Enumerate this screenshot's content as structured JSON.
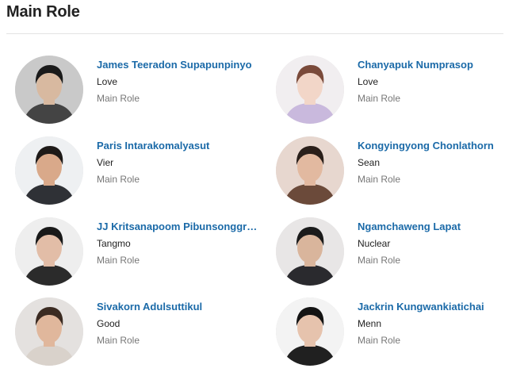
{
  "section": {
    "title": "Main Role"
  },
  "cast": [
    {
      "name": "James Teeradon Supapunpinyo",
      "character": "Love",
      "role": "Main Role",
      "avatar": {
        "bg": "#c9c9c9",
        "hair": "#1a1a1a",
        "skin": "#d8b9a0",
        "shirt": "#444444"
      }
    },
    {
      "name": "Chanyapuk Numprasop",
      "character": "Love",
      "role": "Main Role",
      "avatar": {
        "bg": "#f1eef0",
        "hair": "#7a4a3a",
        "skin": "#f2d6c8",
        "shirt": "#c9b9dd"
      }
    },
    {
      "name": "Paris Intarakomalyasut",
      "character": "Vier",
      "role": "Main Role",
      "avatar": {
        "bg": "#eef0f2",
        "hair": "#1e1a18",
        "skin": "#d9a98a",
        "shirt": "#2f3136"
      }
    },
    {
      "name": "Kongyingyong Chonlathorn",
      "character": "Sean",
      "role": "Main Role",
      "avatar": {
        "bg": "#e7d7cf",
        "hair": "#2a1f1a",
        "skin": "#e2b9a0",
        "shirt": "#6b4a3a"
      }
    },
    {
      "name": "JJ Kritsanapoom Pibunsonggra...",
      "character": "Tangmo",
      "role": "Main Role",
      "avatar": {
        "bg": "#eeeeee",
        "hair": "#191919",
        "skin": "#e2bda7",
        "shirt": "#2b2b2b"
      }
    },
    {
      "name": "Ngamchaweng Lapat",
      "character": "Nuclear",
      "role": "Main Role",
      "avatar": {
        "bg": "#e8e6e6",
        "hair": "#1b1b1b",
        "skin": "#d9b59c",
        "shirt": "#2a2a2e"
      }
    },
    {
      "name": "Sivakorn Adulsuttikul",
      "character": "Good",
      "role": "Main Role",
      "avatar": {
        "bg": "#e4e1df",
        "hair": "#3b2b22",
        "skin": "#e0b79c",
        "shirt": "#d9d2cb"
      }
    },
    {
      "name": "Jackrin Kungwankiatichai",
      "character": "Menn",
      "role": "Main Role",
      "avatar": {
        "bg": "#f3f3f3",
        "hair": "#141414",
        "skin": "#e6c3ad",
        "shirt": "#202020"
      }
    }
  ]
}
